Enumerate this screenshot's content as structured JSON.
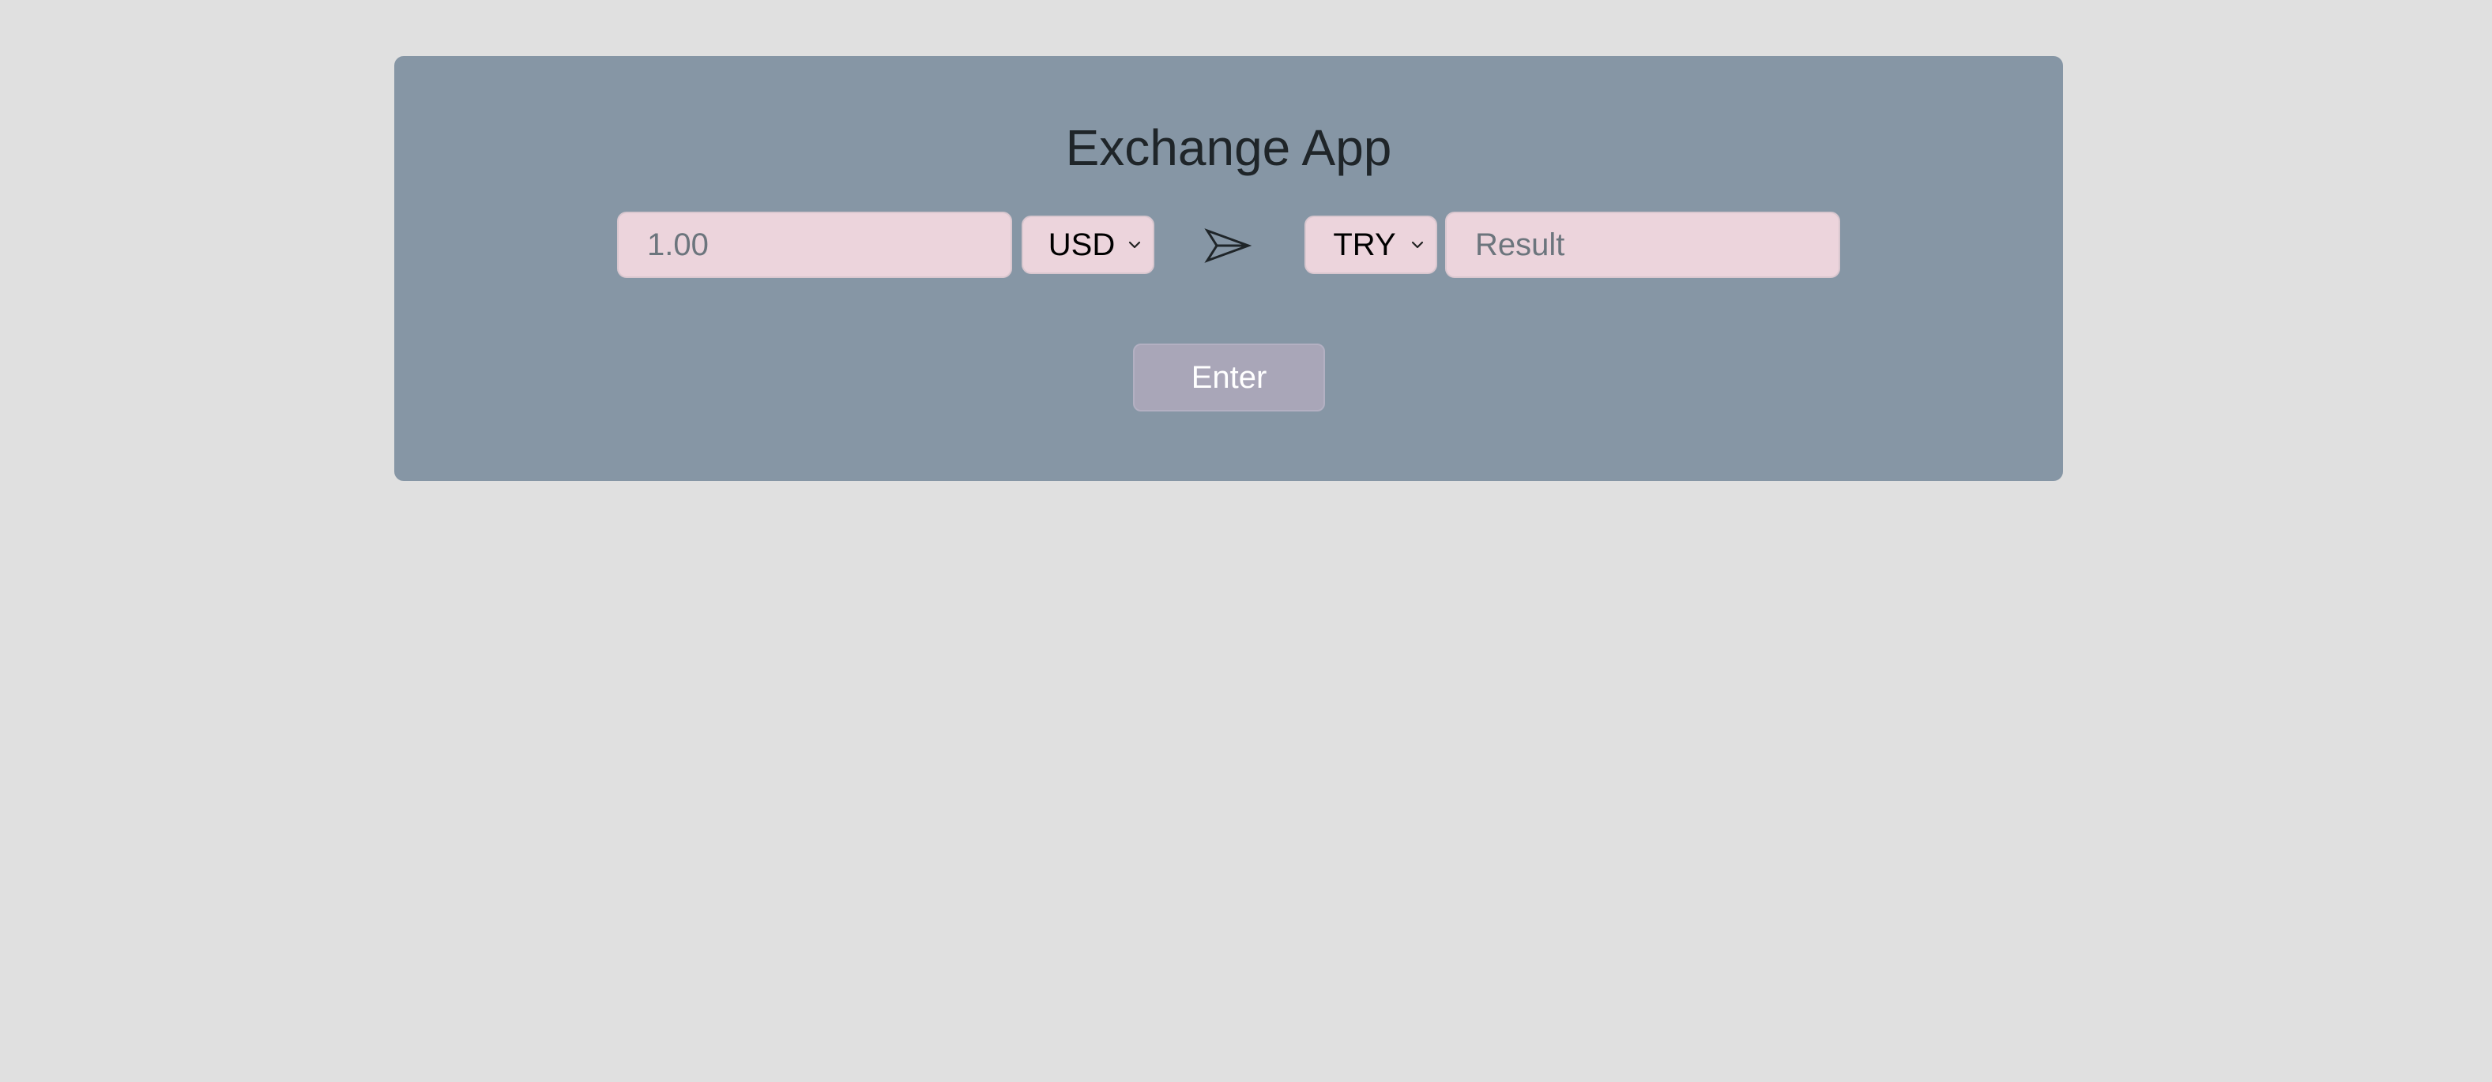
{
  "app": {
    "title": "Exchange App"
  },
  "converter": {
    "amount_placeholder": "1.00",
    "amount_value": "",
    "from_currency": "USD",
    "to_currency": "TRY",
    "result_placeholder": "Result",
    "result_value": "",
    "arrow_icon": "send-arrow-icon",
    "dropdown_icon": "chevron-down-icon"
  },
  "actions": {
    "enter_label": "Enter"
  },
  "colors": {
    "page_background": "#e0e0e0",
    "card_background": "#8696a5",
    "input_background": "#ecd4dc",
    "button_background": "#a9a6b8",
    "title_text": "#1f2529"
  }
}
